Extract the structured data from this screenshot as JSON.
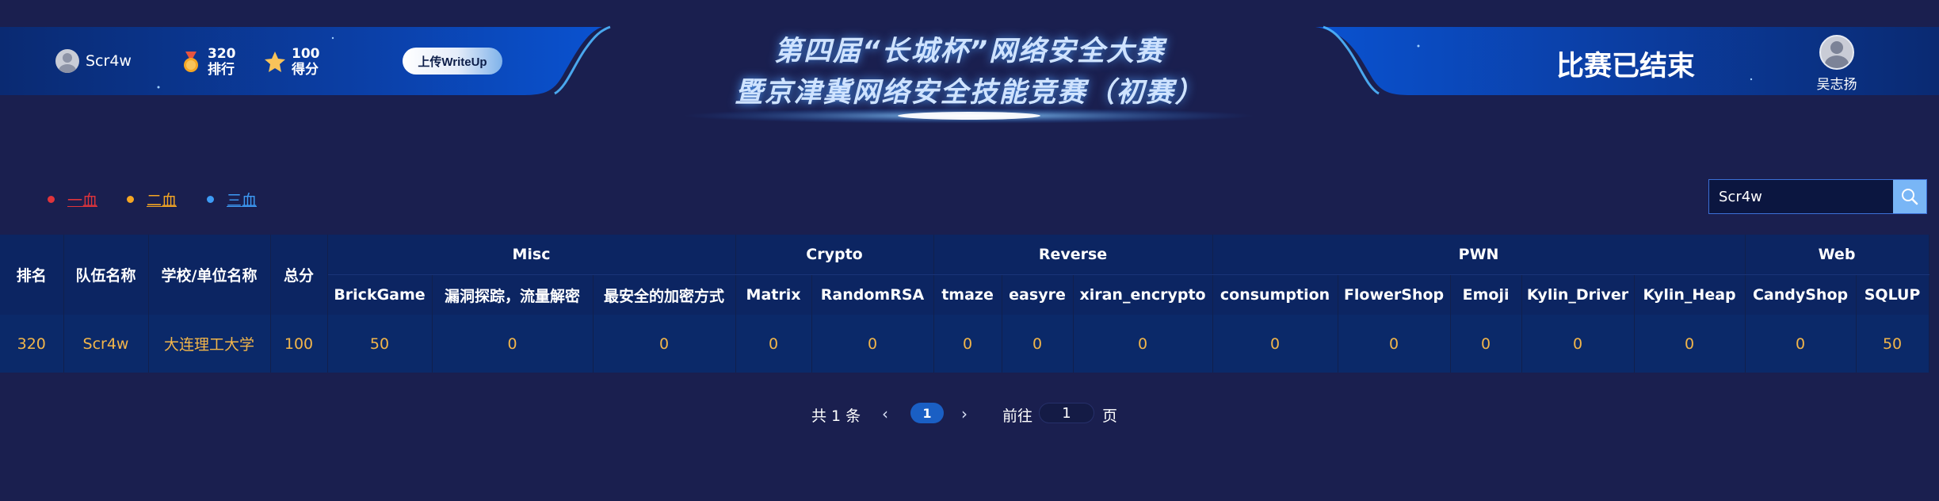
{
  "header": {
    "team_name": "Scr4w",
    "rank_value": "320",
    "rank_label": "排行",
    "score_value": "100",
    "score_label": "得分",
    "upload_label": "上传WriteUp",
    "title_line1": "第四届“长城杯”网络安全大赛",
    "title_line2": "暨京津冀网络安全技能竞赛（初赛）",
    "status": "比赛已结束",
    "user_name": "吴志扬"
  },
  "legend": [
    {
      "label": "一血",
      "color": "#e0343b"
    },
    {
      "label": "二血",
      "color": "#f5a623"
    },
    {
      "label": "三血",
      "color": "#3d9bf5"
    }
  ],
  "search": {
    "value": "Scr4w",
    "icon": "search-icon"
  },
  "table": {
    "fixed_headers": [
      "排名",
      "队伍名称",
      "学校/单位名称",
      "总分"
    ],
    "categories": [
      {
        "name": "Misc",
        "challenges": [
          "BrickGame",
          "漏洞探踪，流量解密",
          "最安全的加密方式"
        ]
      },
      {
        "name": "Crypto",
        "challenges": [
          "Matrix",
          "RandomRSA"
        ]
      },
      {
        "name": "Reverse",
        "challenges": [
          "tmaze",
          "easyre",
          "xiran_encrypto"
        ]
      },
      {
        "name": "PWN",
        "challenges": [
          "consumption",
          "FlowerShop",
          "Emoji",
          "Kylin_Driver",
          "Kylin_Heap"
        ]
      },
      {
        "name": "Web",
        "challenges": [
          "CandyShop",
          "SQLUP"
        ]
      }
    ],
    "rows": [
      {
        "rank": "320",
        "team": "Scr4w",
        "school": "大连理工大学",
        "total": "100",
        "scores": [
          "50",
          "0",
          "0",
          "0",
          "0",
          "0",
          "0",
          "0",
          "0",
          "0",
          "0",
          "0",
          "0",
          "0",
          "50"
        ]
      }
    ]
  },
  "pagination": {
    "total": "共 1 条",
    "prev_icon": "‹",
    "current": "1",
    "next_icon": "›",
    "goto_label": "前往",
    "goto_value": "1",
    "page_label": "页"
  },
  "colors": {
    "background": "#1a1f4f",
    "header_band": "#0b3fa6",
    "table_header": "#0c2562",
    "table_row": "#0b2969",
    "score_text": "#f3b64a",
    "accent": "#79b6f6"
  }
}
